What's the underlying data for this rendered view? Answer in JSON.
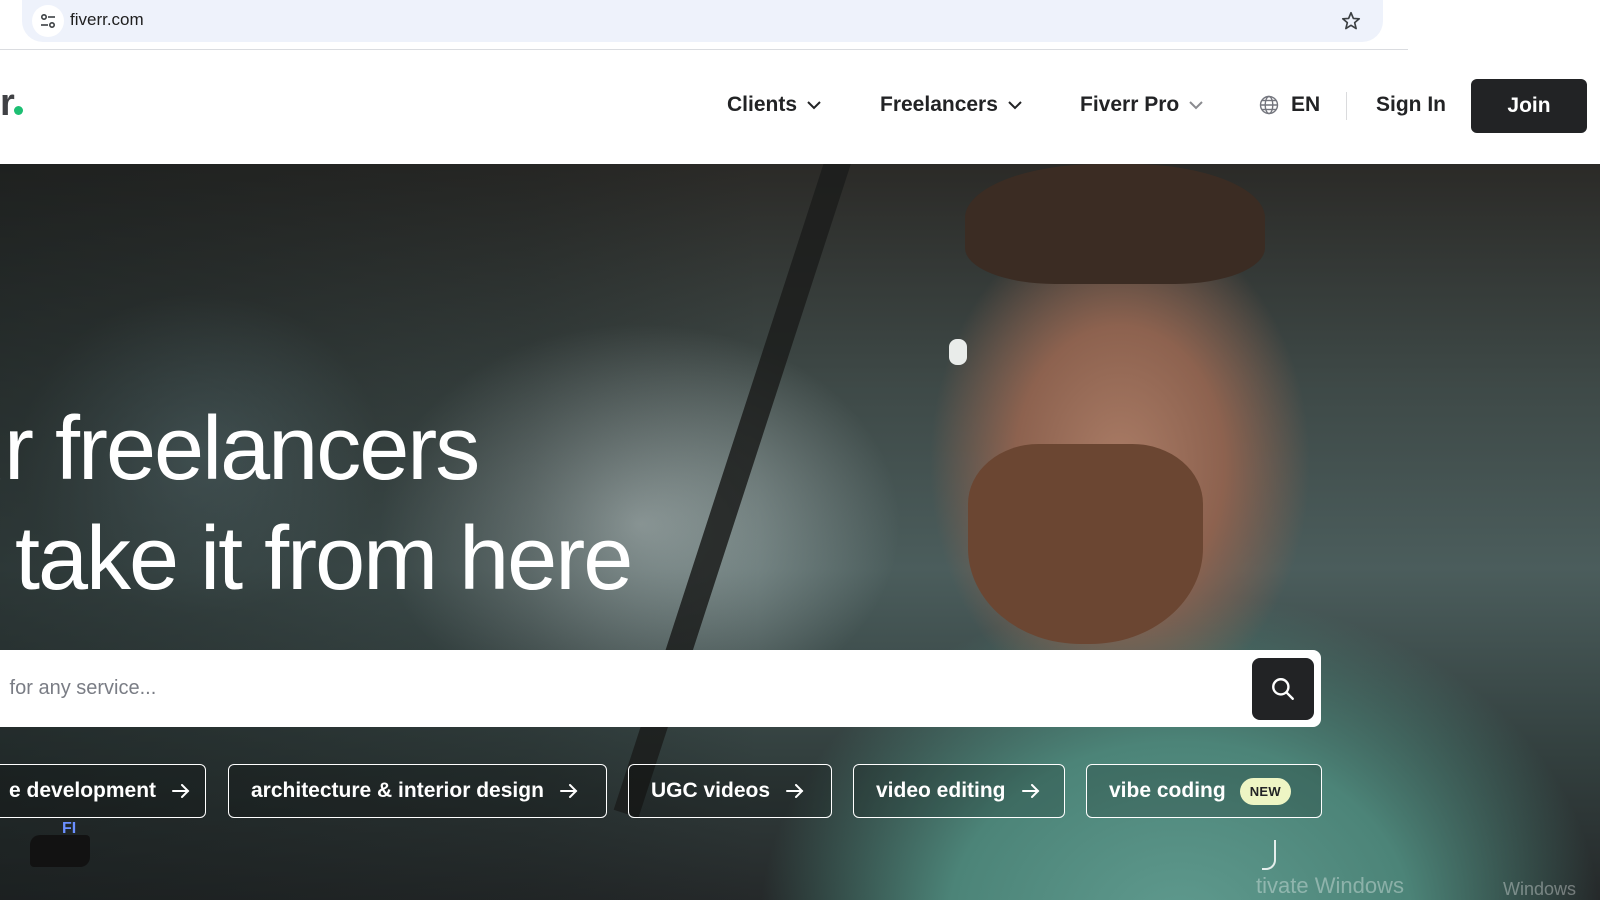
{
  "browser": {
    "url": "fiverr.com",
    "site_info_icon": "tune-icon",
    "bookmark_icon": "star-icon"
  },
  "header": {
    "logo_text": "r",
    "nav": [
      {
        "label": "Clients"
      },
      {
        "label": "Freelancers"
      },
      {
        "label": "Fiverr Pro"
      }
    ],
    "language": "EN",
    "sign_in": "Sign In",
    "join": "Join"
  },
  "hero": {
    "headline_line1": "ur freelancers",
    "headline_line2": "ll take it from here",
    "search": {
      "placeholder": " for any service..."
    },
    "chips": [
      {
        "label": "e development"
      },
      {
        "label": "architecture & interior design"
      },
      {
        "label": "UGC videos"
      },
      {
        "label": "video editing"
      },
      {
        "label": "vibe coding",
        "badge": "NEW"
      }
    ]
  },
  "overlays": {
    "corner_text": "FI",
    "watermark": "tivate Windows",
    "watermark_2": "Windows"
  },
  "colors": {
    "brand_green": "#1dbf73",
    "dark": "#222325",
    "new_badge_bg": "#eef5c4"
  }
}
